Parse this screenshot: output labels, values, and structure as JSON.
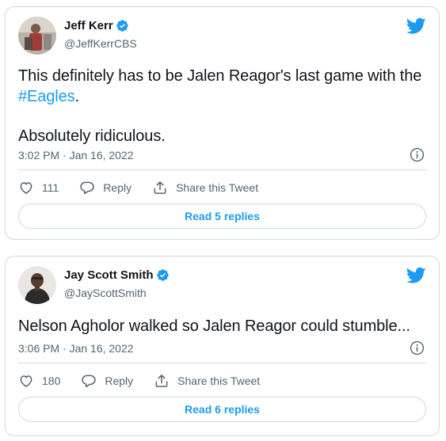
{
  "colors": {
    "link": "#1d9bf0",
    "text": "#0f1419",
    "muted": "#536471",
    "border": "#cfd9de"
  },
  "tweets": [
    {
      "name": "Jeff Kerr",
      "handle": "@JeffKerrCBS",
      "text_before": "This definitely has to be Jalen Reagor's last game with the ",
      "hashtag": "#Eagles",
      "text_after": ".",
      "text_second": "Absolutely ridiculous.",
      "timestamp": "3:02 PM · Jan 16, 2022",
      "like_count": "111",
      "reply_label": "Reply",
      "share_label": "Share this Tweet",
      "read_replies": "Read 5 replies"
    },
    {
      "name": "Jay Scott Smith",
      "handle": "@JayScottSmith",
      "text": "Nelson Agholor walked so Jalen Reagor could stumble...",
      "timestamp": "3:06 PM · Jan 16, 2022",
      "like_count": "180",
      "reply_label": "Reply",
      "share_label": "Share this Tweet",
      "read_replies": "Read 6 replies"
    }
  ],
  "icons": {
    "verified": "verified-badge-icon",
    "bird": "twitter-bird-icon",
    "info": "info-icon",
    "like": "heart-icon",
    "reply": "reply-bubble-icon",
    "share": "share-icon"
  }
}
